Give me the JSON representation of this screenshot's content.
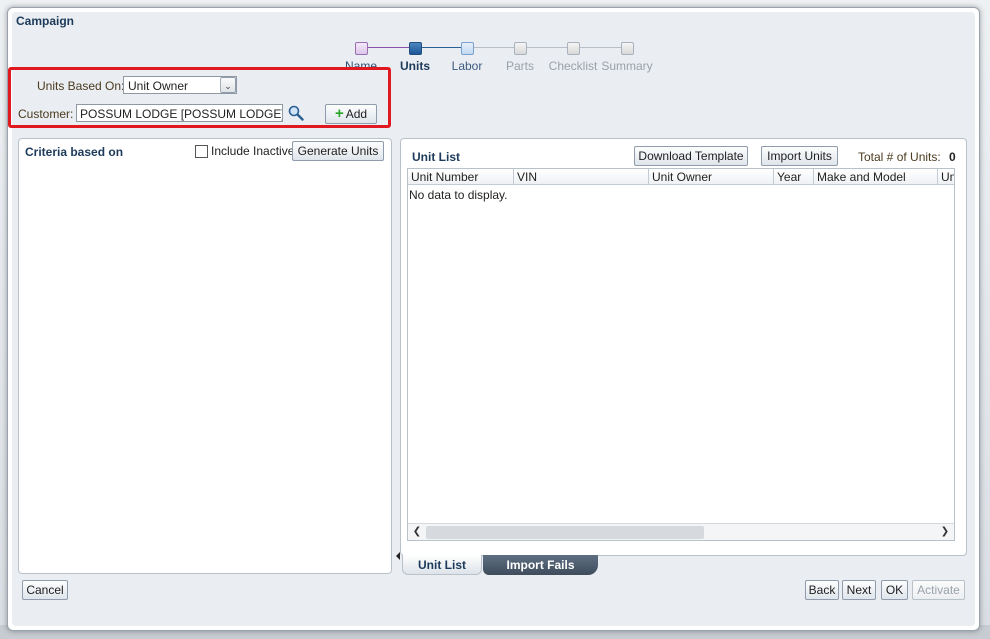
{
  "dialog": {
    "title": "Campaign"
  },
  "train": {
    "stops": [
      {
        "label": "Name",
        "state": "visited"
      },
      {
        "label": "Units",
        "state": "current"
      },
      {
        "label": "Labor",
        "state": "next"
      },
      {
        "label": "Parts",
        "state": "disabled"
      },
      {
        "label": "Checklist",
        "state": "disabled"
      },
      {
        "label": "Summary",
        "state": "disabled"
      }
    ]
  },
  "filters": {
    "units_based_on_label": "Units Based On:",
    "units_based_on_value": "Unit Owner",
    "customer_label": "Customer:",
    "customer_value": "POSSUM LODGE [POSSUM LODGE]",
    "add_label": "Add"
  },
  "criteria": {
    "title": "Criteria based on",
    "include_inactive_label": "Include Inactive",
    "include_inactive_checked": false,
    "generate_label": "Generate Units"
  },
  "unit_list": {
    "title": "Unit List",
    "download_label": "Download Template",
    "import_label": "Import Units",
    "total_label": "Total # of Units:",
    "total_value": "0",
    "columns": [
      "Unit Number",
      "VIN",
      "Unit Owner",
      "Year",
      "Make and Model",
      "Un"
    ],
    "empty_text": "No data to display."
  },
  "tabs": {
    "unit_list": "Unit List",
    "import_fails": "Import Fails"
  },
  "footer": {
    "cancel": "Cancel",
    "back": "Back",
    "next": "Next",
    "ok": "OK",
    "activate": "Activate"
  },
  "colors": {
    "highlight": "#e0181f",
    "title": "#1c3a5a",
    "add_plus": "#2aa52a"
  }
}
